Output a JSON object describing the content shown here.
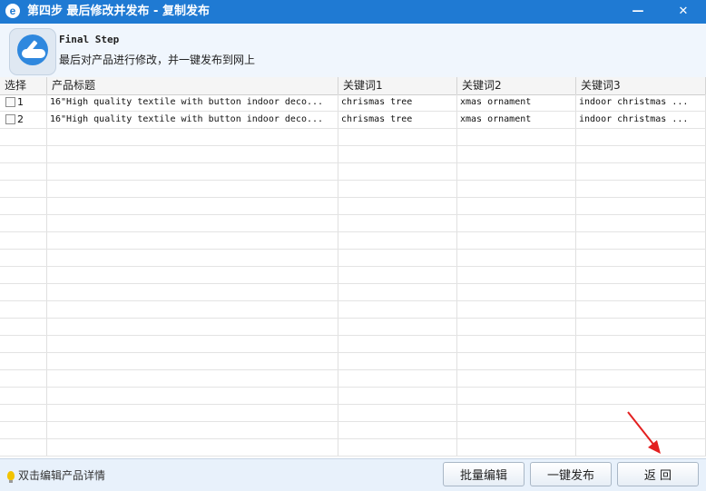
{
  "window": {
    "title": "第四步 最后修改并发布 - 复制发布",
    "minimize_label": "—",
    "close_label": "✕",
    "app_icon_glyph": "e"
  },
  "header": {
    "step_title": "Final Step",
    "step_desc": "最后对产品进行修改，并一键发布到网上"
  },
  "table": {
    "columns": [
      "选择",
      "产品标题",
      "关键词1",
      "关键词2",
      "关键词3"
    ],
    "rows": [
      {
        "index": "1",
        "title": "16\"High quality textile with button indoor deco...",
        "kw1": "chrismas tree",
        "kw2": "xmas ornament",
        "kw3": "indoor christmas ..."
      },
      {
        "index": "2",
        "title": "16\"High quality textile with button indoor deco...",
        "kw1": "chrismas tree",
        "kw2": "xmas ornament",
        "kw3": "indoor christmas ..."
      }
    ]
  },
  "footer": {
    "hint": "双击编辑产品详情",
    "batch_edit_label": "批量编辑",
    "one_click_publish_label": "一键发布",
    "back_label": "返 回"
  },
  "colors": {
    "titlebar": "#1f7ad3",
    "annotation_arrow": "#e32020"
  }
}
